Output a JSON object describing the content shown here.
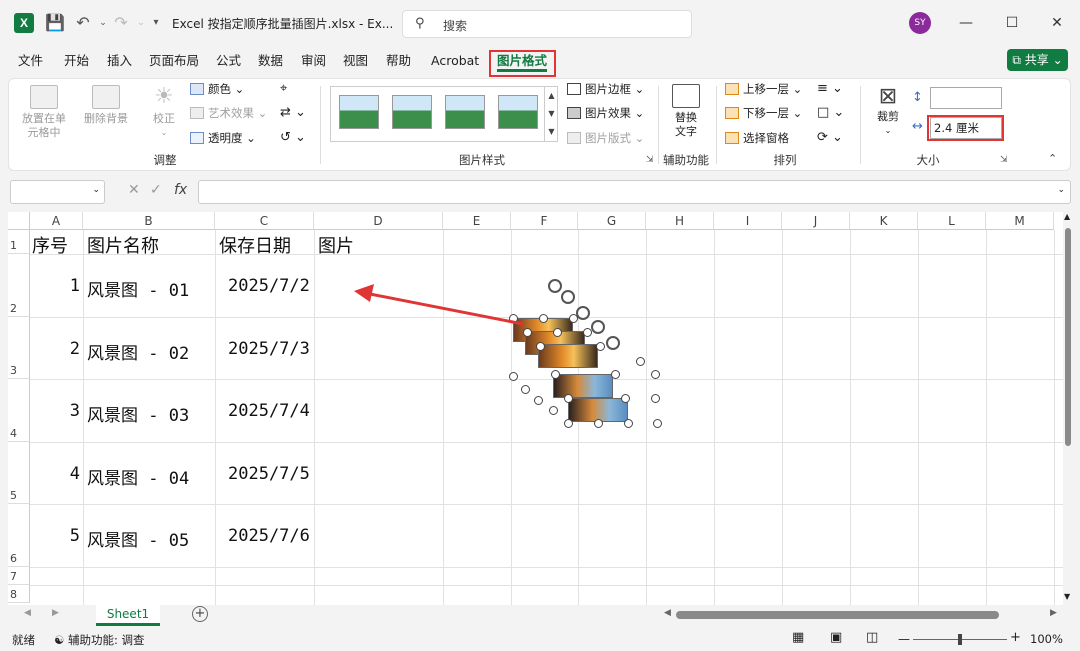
{
  "window": {
    "title": "Excel 按指定顺序批量插图片.xlsx  -  Ex...",
    "search_placeholder": "搜索",
    "avatar_initials": "SY"
  },
  "tabs": [
    "文件",
    "开始",
    "插入",
    "页面布局",
    "公式",
    "数据",
    "审阅",
    "视图",
    "帮助",
    "Acrobat",
    "图片格式"
  ],
  "active_tab": "图片格式",
  "share_label": "共享",
  "ribbon": {
    "adjust": {
      "label": "调整",
      "remove_bg": "删除背景",
      "correct": "校正",
      "color": "颜色",
      "art": "艺术效果",
      "transparency": "透明度",
      "place_in_cell": "放置在单元格中"
    },
    "styles": {
      "label": "图片样式",
      "border": "图片边框",
      "effects": "图片效果",
      "layout": "图片版式"
    },
    "accessibility": {
      "label": "辅助功能",
      "alt_text_1": "替换",
      "alt_text_2": "文字"
    },
    "arrange": {
      "label": "排列",
      "forward": "上移一层",
      "backward": "下移一层",
      "selection_pane": "选择窗格"
    },
    "size": {
      "label": "大小",
      "crop": "裁剪",
      "height": "",
      "width": "2.4 厘米"
    }
  },
  "columns": [
    "A",
    "B",
    "C",
    "D",
    "E",
    "F",
    "G",
    "H",
    "I",
    "J",
    "K",
    "L",
    "M"
  ],
  "row_numbers": [
    "1",
    "2",
    "3",
    "4",
    "5",
    "6",
    "7",
    "8"
  ],
  "headers": {
    "a": "序号",
    "b": "图片名称",
    "c": "保存日期",
    "d": "图片"
  },
  "rows": [
    {
      "a": "1",
      "b": "风景图 - 01",
      "c": "2025/7/2"
    },
    {
      "a": "2",
      "b": "风景图 - 02",
      "c": "2025/7/3"
    },
    {
      "a": "3",
      "b": "风景图 - 03",
      "c": "2025/7/4"
    },
    {
      "a": "4",
      "b": "风景图 - 04",
      "c": "2025/7/5"
    },
    {
      "a": "5",
      "b": "风景图 - 05",
      "c": "2025/7/6"
    }
  ],
  "sheet_tab": "Sheet1",
  "status": {
    "ready": "就绪",
    "accessibility": "辅助功能: 调查",
    "zoom": "100%"
  },
  "colors": {
    "accent": "#107c41",
    "highlight": "#e03535"
  }
}
